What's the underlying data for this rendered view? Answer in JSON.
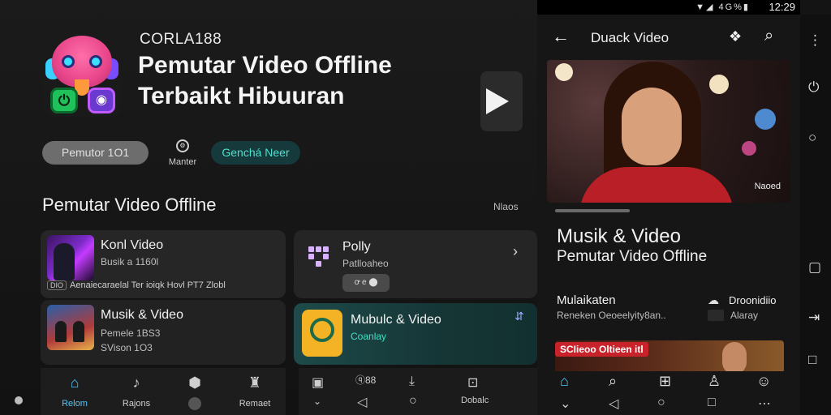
{
  "left": {
    "brand": "CORLA188",
    "hero_title_line1": "Pemutar Video Offline",
    "hero_title_line2": "Terbaikt Hibuuran",
    "chips": {
      "gray": "Pemutor 1O1",
      "middle_label": "Manter",
      "teal": "Genchá Neer"
    },
    "section_title": "Pemutar Video Offline",
    "section_more": "Nlaos",
    "cards": [
      {
        "title": "Konl Video",
        "line2": "Busik a 1160l",
        "ribbon_tag": "DIO",
        "ribbon": "Aenaiecaraelal Ter ioiqk Hovl PT7 Zlobl"
      },
      {
        "title": "Musik & Video",
        "line2": "Pemele 1BS3",
        "line3": "SVison 1O3"
      },
      {
        "title": "Polly",
        "line2": "Patlloaheo",
        "mini": "ꝍ e ⬤"
      },
      {
        "title": "Mubulc & Video",
        "line2": "Coanlay"
      }
    ],
    "nav": [
      {
        "label": "Relom",
        "icon": "home-icon"
      },
      {
        "label": "Rajons",
        "icon": "music-note-icon"
      },
      {
        "label": "",
        "icon": "hexagon-icon"
      },
      {
        "label": "Remaet",
        "icon": "rocket-icon"
      }
    ],
    "nav2": {
      "mid_label": "ⓠ88",
      "right_label": "Dobalc"
    }
  },
  "phone": {
    "status_time": "12:29",
    "status_icons": "▼◢ 4G%▮",
    "title": "Duack Video",
    "video_badge": "Naoed",
    "title_line1": "Musik & Video",
    "title_line2": "Pemutar Video Offline",
    "row_left_head": "Mulaikaten",
    "row_left_sub": "Reneken Oeoeelyity8an..",
    "row_right_head": "Droonidiio",
    "row_right_sub": "Alaray",
    "promo_label": "SCIieoo Oltieen itl"
  },
  "colors": {
    "accent_blue": "#4cc9ff",
    "teal_text": "#4fe0cf",
    "promo_red": "#c8222a"
  }
}
